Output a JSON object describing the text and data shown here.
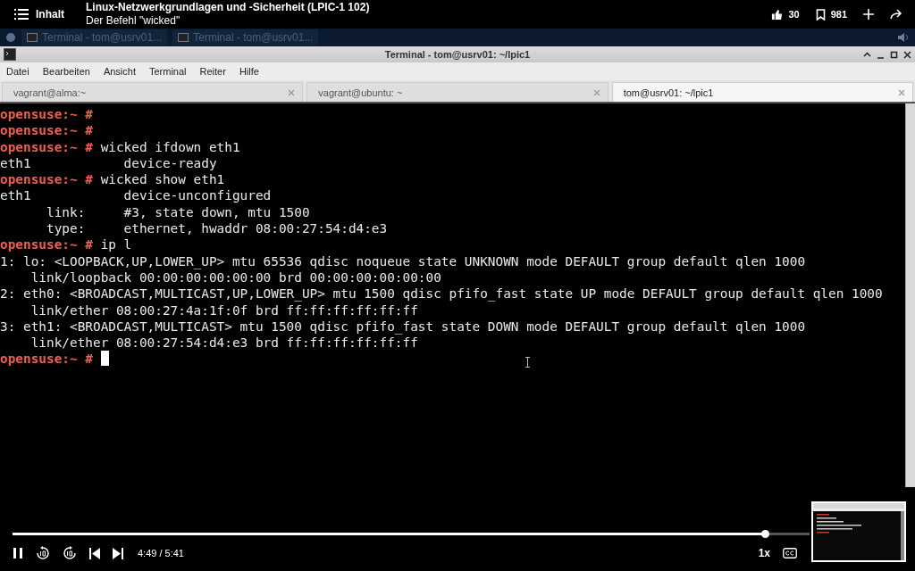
{
  "header": {
    "contents_label": "Inhalt",
    "course_title": "Linux-Netzwerkgrundlagen und -Sicherheit (LPIC-1 102)",
    "lesson_title": "Der Befehl \"wicked\"",
    "likes": "30",
    "saves": "981"
  },
  "taskbar": {
    "tasks": [
      "Terminal - tom@usrv01...",
      "Terminal - tom@usrv01..."
    ]
  },
  "window": {
    "title": "Terminal - tom@usrv01: ~/lpic1"
  },
  "menu": [
    "Datei",
    "Bearbeiten",
    "Ansicht",
    "Terminal",
    "Reiter",
    "Hilfe"
  ],
  "tabs": [
    {
      "label": "vagrant@alma:~",
      "selected": false
    },
    {
      "label": "vagrant@ubuntu: ~",
      "selected": false
    },
    {
      "label": "tom@usrv01: ~/lpic1",
      "selected": true
    }
  ],
  "terminal": {
    "lines": [
      {
        "prompt": "opensuse:~ #"
      },
      {
        "prompt": "opensuse:~ #"
      },
      {
        "prompt": "opensuse:~ #",
        "text": " wicked ifdown eth1"
      },
      {
        "text": "eth1            device-ready"
      },
      {
        "prompt": "opensuse:~ #",
        "text": " wicked show eth1"
      },
      {
        "text": "eth1            device-unconfigured"
      },
      {
        "text": "      link:     #3, state down, mtu 1500"
      },
      {
        "text": "      type:     ethernet, hwaddr 08:00:27:54:d4:e3"
      },
      {
        "prompt": "opensuse:~ #",
        "text": " ip l"
      },
      {
        "text": "1: lo: <LOOPBACK,UP,LOWER_UP> mtu 65536 qdisc noqueue state UNKNOWN mode DEFAULT group default qlen 1000"
      },
      {
        "text": "    link/loopback 00:00:00:00:00:00 brd 00:00:00:00:00:00"
      },
      {
        "text": "2: eth0: <BROADCAST,MULTICAST,UP,LOWER_UP> mtu 1500 qdisc pfifo_fast state UP mode DEFAULT group default qlen 1000"
      },
      {
        "text": "    link/ether 08:00:27:4a:1f:0f brd ff:ff:ff:ff:ff:ff"
      },
      {
        "text": "3: eth1: <BROADCAST,MULTICAST> mtu 1500 qdisc pfifo_fast state DOWN mode DEFAULT group default qlen 1000"
      },
      {
        "text": "    link/ether 08:00:27:54:d4:e3 brd ff:ff:ff:ff:ff:ff"
      },
      {
        "prompt": "opensuse:~ #",
        "cursor": true
      }
    ]
  },
  "player": {
    "level": 0.945,
    "time": "4:49 / 5:41",
    "speed": "1x",
    "playing": true
  }
}
